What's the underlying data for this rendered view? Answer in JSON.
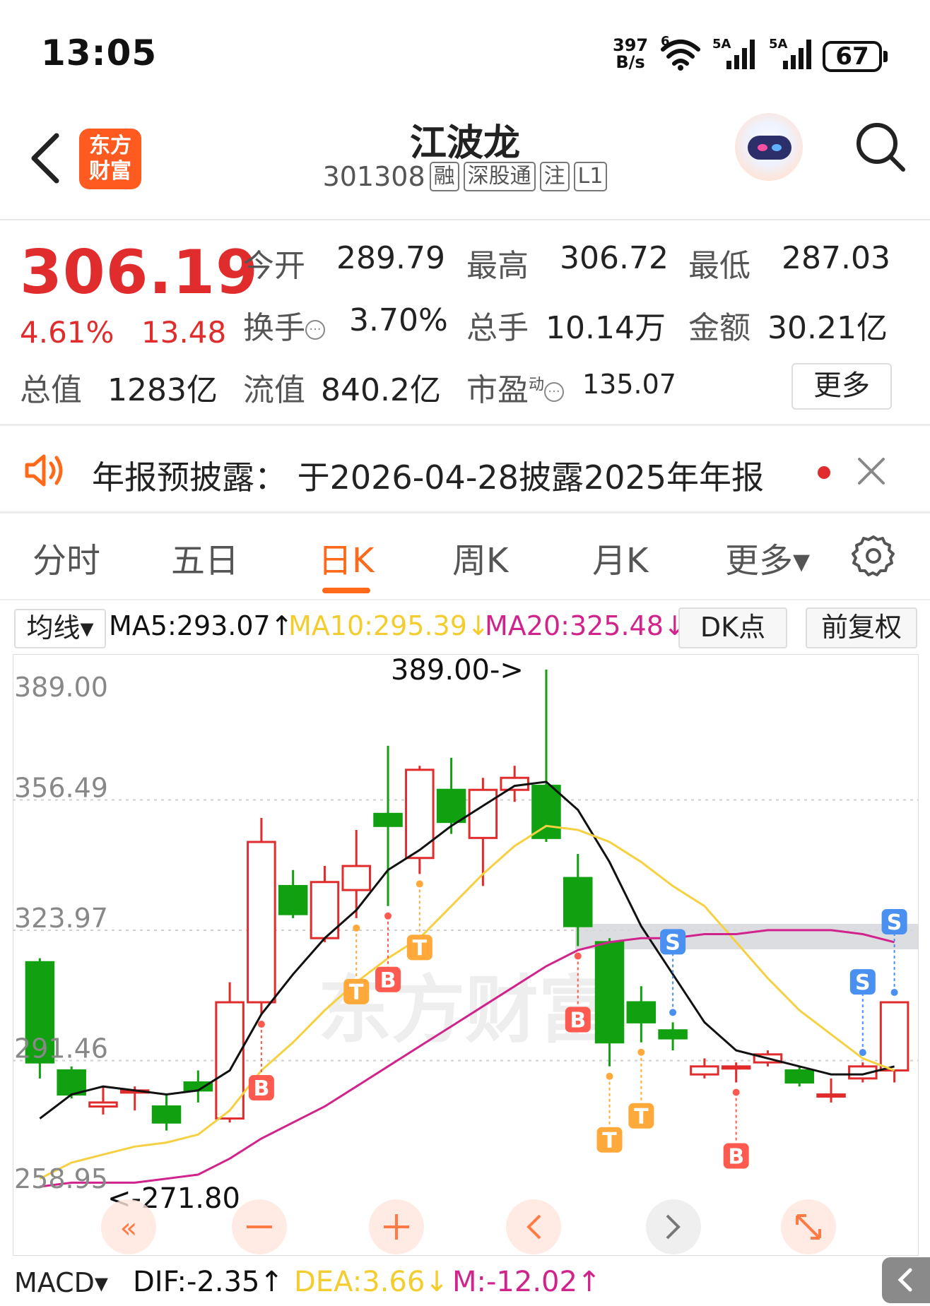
{
  "status_bar": {
    "time": "13:05",
    "net_speed_value": "397",
    "net_speed_unit": "B/s",
    "wifi_label": "6",
    "sim1_label": "5A",
    "sim2_label": "5A",
    "battery": "67"
  },
  "header": {
    "stock_name": "江波龙",
    "stock_code": "301308",
    "tags": [
      "融",
      "深股通",
      "注",
      "L1"
    ],
    "logo_line1": "东方",
    "logo_line2": "财富"
  },
  "quote": {
    "price": "306.19",
    "change_pct": "4.61%",
    "change": "13.48",
    "open_label": "今开",
    "open": "289.79",
    "high_label": "最高",
    "high": "306.72",
    "low_label": "最低",
    "low": "287.03",
    "turnover_label": "换手",
    "turnover": "3.70%",
    "volume_label": "总手",
    "volume": "10.14万",
    "amount_label": "金额",
    "amount": "30.21亿",
    "mktcap_label": "总值",
    "mktcap": "1283亿",
    "float_label": "流值",
    "float_cap": "840.2亿",
    "pe_label": "市盈",
    "pe_sup": "动",
    "pe": "135.07",
    "more_label": "更多"
  },
  "notice": {
    "text": "年报预披露：  于2026-04-28披露2025年年报"
  },
  "tabs": [
    {
      "label": "分时"
    },
    {
      "label": "五日"
    },
    {
      "label": "日K"
    },
    {
      "label": "周K"
    },
    {
      "label": "月K"
    },
    {
      "label": "更多▾"
    }
  ],
  "ma_row": {
    "select_label": "均线▾",
    "ma5": "MA5:293.07↑",
    "ma10": "MA10:295.39↓",
    "ma20": "MA20:325.48↓",
    "dk_label": "DK点",
    "fq_label": "前复权"
  },
  "colors": {
    "up": "#e02c2c",
    "down": "#10a010",
    "ma5": "#111111",
    "ma10": "#f5d142",
    "ma20": "#d0248c",
    "accent": "#ff6a1a"
  },
  "chart_data": {
    "type": "candlestick",
    "y_ticks": [
      "389.00",
      "356.49",
      "323.97",
      "291.46",
      "258.95"
    ],
    "ylim": [
      258.95,
      389.0
    ],
    "max_annotation": "389.00->",
    "min_annotation": "<-271.80",
    "watermark": "东方财富",
    "candles": [
      {
        "o": 316,
        "c": 291,
        "h": 317,
        "l": 287
      },
      {
        "o": 289,
        "c": 283,
        "h": 290,
        "l": 282
      },
      {
        "o": 280,
        "c": 281,
        "h": 285,
        "l": 278
      },
      {
        "o": 284,
        "c": 284,
        "h": 285,
        "l": 279
      },
      {
        "o": 280,
        "c": 276,
        "h": 283,
        "l": 274
      },
      {
        "o": 286,
        "c": 284,
        "h": 289,
        "l": 281
      },
      {
        "o": 277,
        "c": 306,
        "h": 311,
        "l": 276
      },
      {
        "o": 306,
        "c": 346,
        "h": 352,
        "l": 303
      },
      {
        "o": 335,
        "c": 328,
        "h": 339,
        "l": 327
      },
      {
        "o": 322,
        "c": 336,
        "h": 340,
        "l": 321
      },
      {
        "o": 334,
        "c": 340,
        "h": 349,
        "l": 327
      },
      {
        "o": 353,
        "c": 350,
        "h": 370,
        "l": 330
      },
      {
        "o": 342,
        "c": 364,
        "h": 365,
        "l": 338
      },
      {
        "o": 359,
        "c": 351,
        "h": 367,
        "l": 348
      },
      {
        "o": 347,
        "c": 359,
        "h": 362,
        "l": 335
      },
      {
        "o": 359,
        "c": 362,
        "h": 365,
        "l": 356
      },
      {
        "o": 360,
        "c": 347,
        "h": 389,
        "l": 346
      },
      {
        "o": 337,
        "c": 325,
        "h": 343,
        "l": 320
      },
      {
        "o": 321,
        "c": 296,
        "h": 322,
        "l": 290
      },
      {
        "o": 306,
        "c": 301,
        "h": 310,
        "l": 296
      },
      {
        "o": 299,
        "c": 297,
        "h": 301,
        "l": 294
      },
      {
        "o": 288,
        "c": 290,
        "h": 292,
        "l": 287
      },
      {
        "o": 290,
        "c": 290,
        "h": 291,
        "l": 286
      },
      {
        "o": 291,
        "c": 293,
        "h": 294,
        "l": 290
      },
      {
        "o": 289,
        "c": 286,
        "h": 290,
        "l": 285
      },
      {
        "o": 283,
        "c": 283,
        "h": 287,
        "l": 281
      },
      {
        "o": 287,
        "c": 290,
        "h": 291,
        "l": 286
      },
      {
        "o": 289,
        "c": 306,
        "h": 306,
        "l": 286
      }
    ],
    "series": [
      {
        "name": "MA5",
        "values": [
          277,
          283,
          285,
          284,
          283,
          284,
          289,
          303,
          313,
          322,
          329,
          339,
          344,
          350,
          355,
          360,
          361,
          354,
          341,
          325,
          313,
          301,
          294,
          292,
          290,
          288,
          288,
          290
        ]
      },
      {
        "name": "MA10",
        "values": [
          262,
          266,
          268,
          270,
          271,
          273,
          279,
          289,
          296,
          304,
          311,
          317,
          322,
          330,
          338,
          345,
          350,
          349,
          346,
          341,
          335,
          330,
          321,
          312,
          304,
          298,
          292,
          289
        ]
      },
      {
        "name": "MA20",
        "values": [
          260,
          261,
          261,
          261,
          262,
          263,
          267,
          272,
          276,
          280,
          285,
          290,
          295,
          300,
          305,
          310,
          315,
          319,
          321,
          322,
          322,
          323,
          323,
          324,
          324,
          324,
          323,
          321
        ]
      }
    ],
    "signals": [
      {
        "i": 7,
        "label": "B"
      },
      {
        "i": 10,
        "label": "T"
      },
      {
        "i": 11,
        "label": "B"
      },
      {
        "i": 12,
        "label": "T"
      },
      {
        "i": 17,
        "label": "B"
      },
      {
        "i": 18,
        "label": "T"
      },
      {
        "i": 19,
        "label": "T"
      },
      {
        "i": 20,
        "label": "S"
      },
      {
        "i": 22,
        "label": "B"
      },
      {
        "i": 26,
        "label": "S"
      },
      {
        "i": 27,
        "label": "S"
      }
    ]
  },
  "macd_row": {
    "select_label": "MACD▾",
    "dif": "DIF:-2.35↑",
    "dea": "DEA:3.66↓",
    "m": "M:-12.02↑"
  }
}
